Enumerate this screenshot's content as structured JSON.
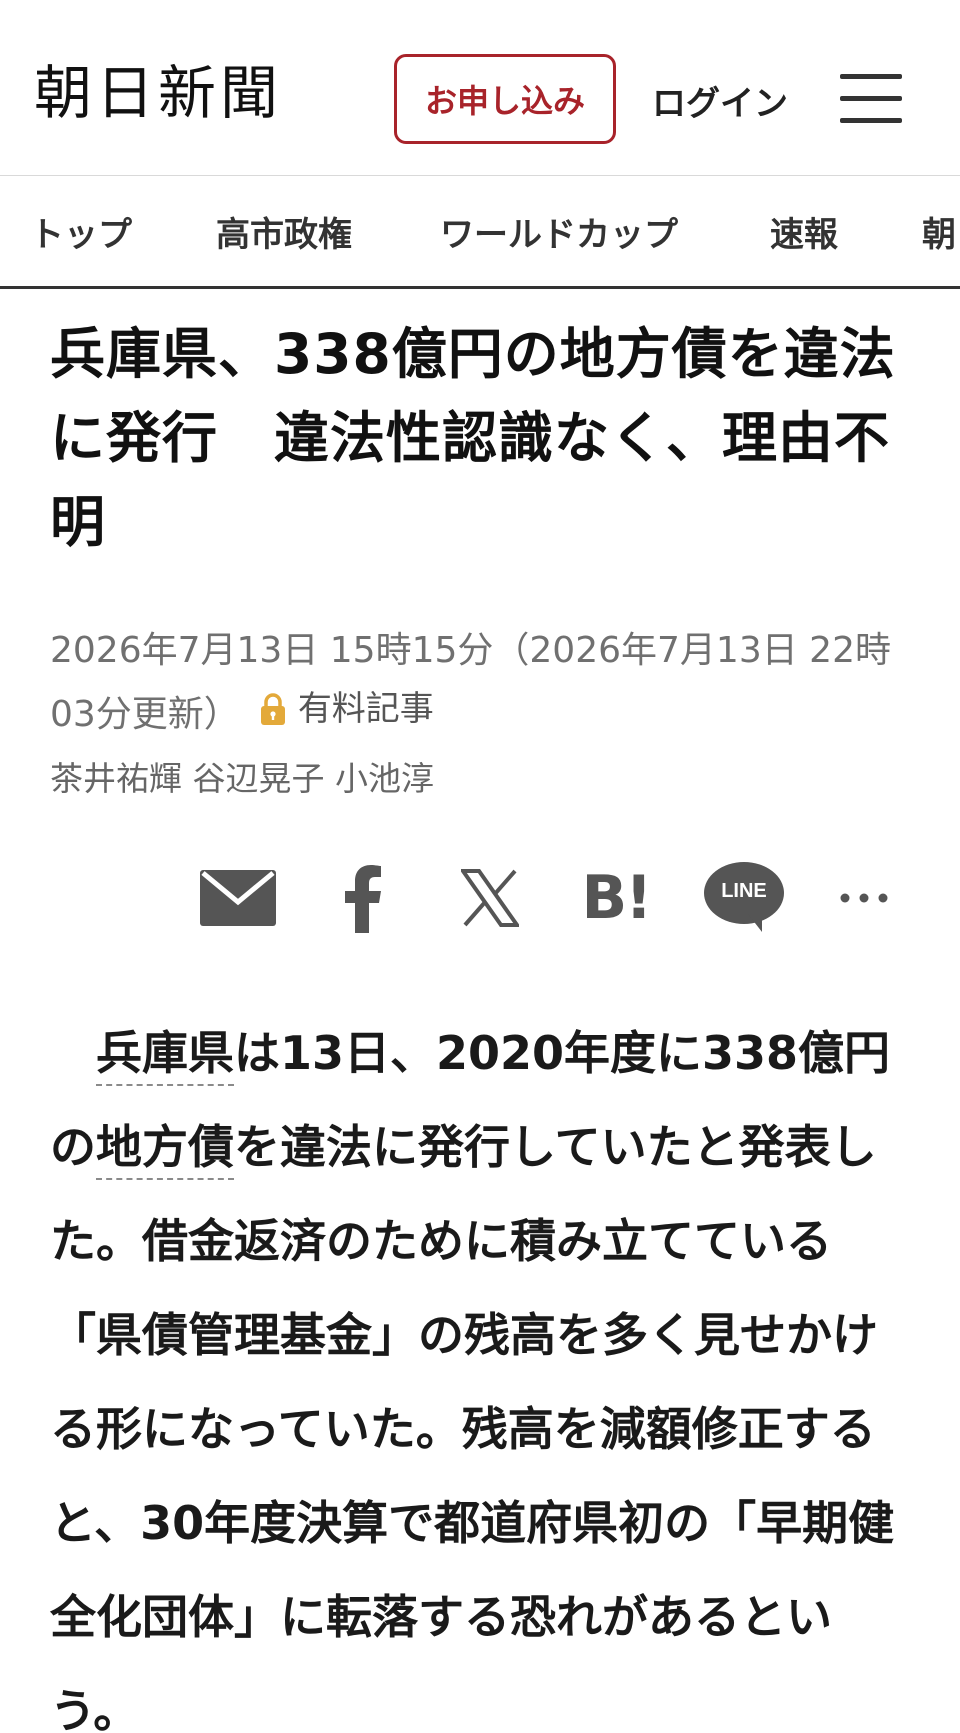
{
  "header": {
    "logo": "朝日新聞",
    "apply_label": "お申し込み",
    "login_label": "ログイン"
  },
  "nav": {
    "items": [
      "トップ",
      "高市政権",
      "ワールドカップ",
      "速報",
      "朝日"
    ]
  },
  "article": {
    "headline": "兵庫県、338億円の地方債を違法に発行　違法性認識なく、理由不明",
    "date_text": "2026年7月13日 15時15分（2026年7月13日 22時03分更新）",
    "paid_label": "有料記事",
    "authors": "茶井祐輝 谷辺晃子 小池淳",
    "body": {
      "term1": "兵庫県",
      "text1": "は13日、2020年度に338億円の",
      "term2": "地方債",
      "text2": "を違法に発行していたと発表した。借金返済のために積み立てている「県債管理基金」の残高を多く見せかける形になっていた。残高を減額修正すると、30年度決算で都道府県初の「早期健全化団体」に転落する恐れがあるという。"
    }
  },
  "share": {
    "icons": [
      "mail-icon",
      "facebook-icon",
      "x-icon",
      "hatena-bookmark-icon",
      "line-icon",
      "more-icon"
    ],
    "line_label": "LINE",
    "hatena_label": "B!"
  },
  "colors": {
    "brand_red": "#a8232a",
    "lock_gold": "#e3a93a",
    "icon_gray": "#555555"
  }
}
